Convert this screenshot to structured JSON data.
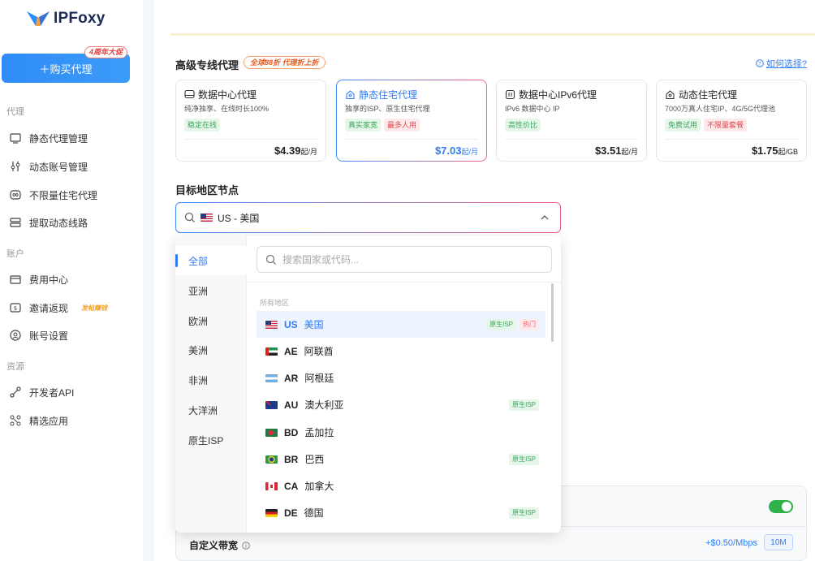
{
  "sidebar": {
    "logo": "IPFoxy",
    "buy_button": "＋购买代理",
    "promo": "4周年大促",
    "sections": {
      "proxy": "代理",
      "account": "账户",
      "resources": "资源"
    },
    "items": [
      {
        "label": "静态代理管理"
      },
      {
        "label": "动态账号管理"
      },
      {
        "label": "不限量住宅代理"
      },
      {
        "label": "提取动态线路"
      },
      {
        "label": "费用中心"
      },
      {
        "label": "邀请返现",
        "badge": "发帖赚钱"
      },
      {
        "label": "账号设置"
      },
      {
        "label": "开发者API"
      },
      {
        "label": "精选应用"
      }
    ]
  },
  "proxy_section": {
    "title": "高级专线代理",
    "discount": "全球88折 代理折上折",
    "help_link": "如何选择?",
    "cards": [
      {
        "title": "数据中心代理",
        "desc": "纯净独享、在线时长100%",
        "tags": [
          {
            "text": "稳定在线",
            "color": "green"
          }
        ],
        "price": "$4.39",
        "unit": "起/月"
      },
      {
        "title": "静态住宅代理",
        "desc": "独享的ISP、原生住宅代理",
        "tags": [
          {
            "text": "真实家宽",
            "color": "green"
          },
          {
            "text": "最多人用",
            "color": "red"
          }
        ],
        "price": "$7.03",
        "unit": "起/月"
      },
      {
        "title": "数据中心IPv6代理",
        "desc": "IPv6 数据中心 IP",
        "tags": [
          {
            "text": "高性价比",
            "color": "green"
          }
        ],
        "price": "$3.51",
        "unit": "起/月"
      },
      {
        "title": "动态住宅代理",
        "desc": "7000万真人住宅IP、4G/5G代理池",
        "tags": [
          {
            "text": "免费试用",
            "color": "green"
          },
          {
            "text": "不限量套餐",
            "color": "red"
          }
        ],
        "price": "$1.75",
        "unit": "起/GB"
      }
    ]
  },
  "region_section": {
    "title": "目标地区节点",
    "selected": "US - 美国",
    "search_placeholder": "搜索国家或代码...",
    "regions": [
      "全部",
      "亚洲",
      "欧洲",
      "美洲",
      "非洲",
      "大洋洲",
      "原生ISP"
    ],
    "list_header": "所有地区",
    "countries": [
      {
        "code": "US",
        "name": "美国",
        "flag": "f-us",
        "badges": [
          {
            "text": "原生ISP",
            "type": "isp"
          },
          {
            "text": "热门",
            "type": "hot"
          }
        ]
      },
      {
        "code": "AE",
        "name": "阿联酋",
        "flag": "f-ae",
        "badges": []
      },
      {
        "code": "AR",
        "name": "阿根廷",
        "flag": "f-ar",
        "badges": []
      },
      {
        "code": "AU",
        "name": "澳大利亚",
        "flag": "f-au",
        "badges": [
          {
            "text": "原生ISP",
            "type": "isp"
          }
        ]
      },
      {
        "code": "BD",
        "name": "孟加拉",
        "flag": "f-bd",
        "badges": []
      },
      {
        "code": "BR",
        "name": "巴西",
        "flag": "f-br",
        "badges": [
          {
            "text": "原生ISP",
            "type": "isp"
          }
        ]
      },
      {
        "code": "CA",
        "name": "加拿大",
        "flag": "f-ca",
        "badges": []
      },
      {
        "code": "DE",
        "name": "德国",
        "flag": "f-de",
        "badges": [
          {
            "text": "原生ISP",
            "type": "isp"
          }
        ]
      }
    ]
  },
  "bandwidth": {
    "label": "自定义带宽",
    "price": "+$0.50/Mbps",
    "value": "10M"
  },
  "colors": {
    "accent": "#2f7cf5",
    "gradient_end": "#f0648a",
    "toggle_on": "#2fb04a"
  }
}
